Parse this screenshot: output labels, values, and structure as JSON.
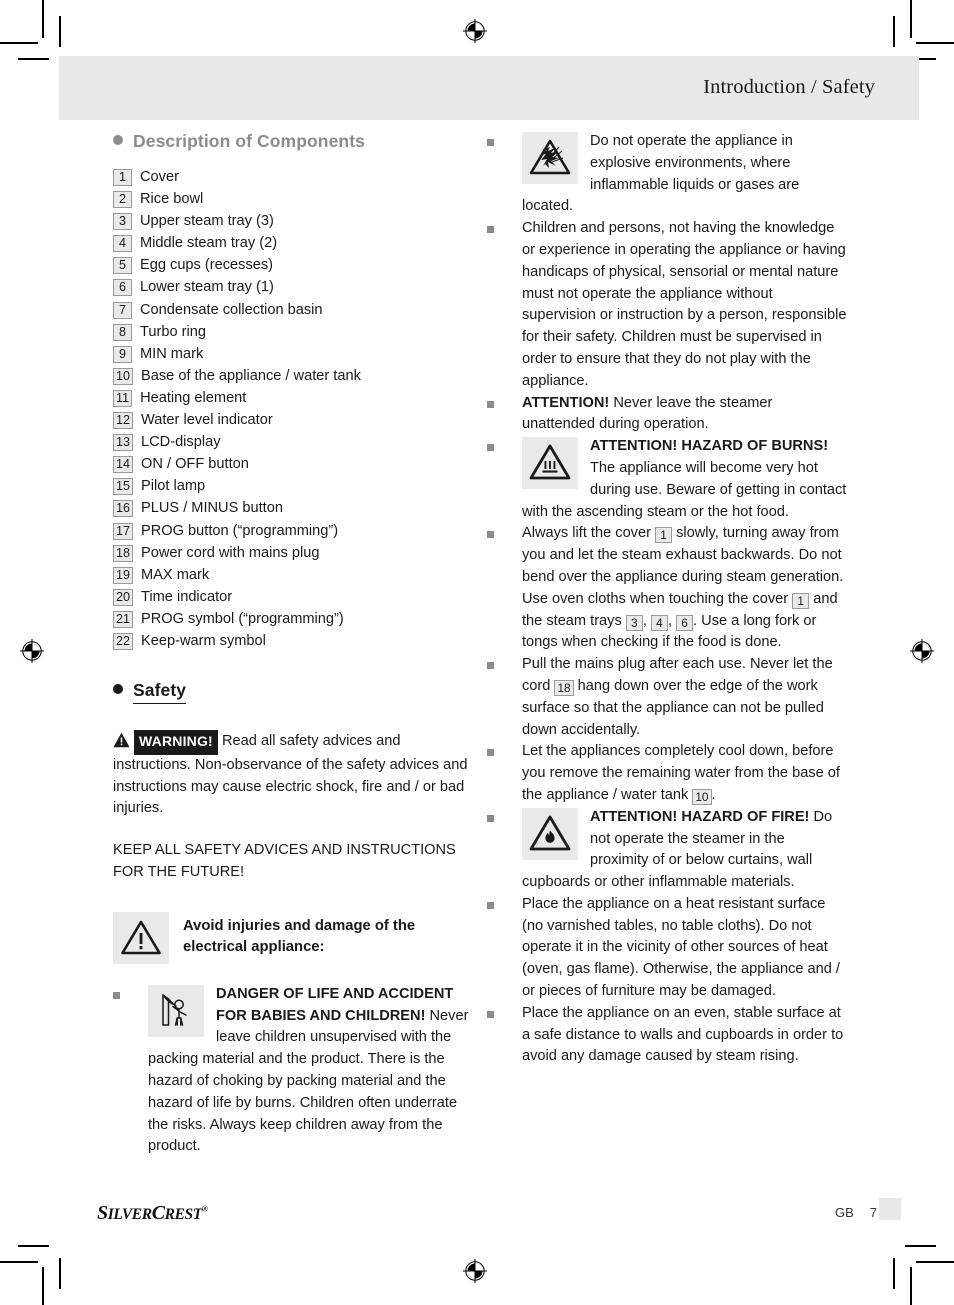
{
  "header": {
    "title": "Introduction / Safety"
  },
  "sections": {
    "components": {
      "heading": "Description of Components",
      "bullet_icon": "filled-circle-icon",
      "items": [
        {
          "num": "1",
          "label": "Cover"
        },
        {
          "num": "2",
          "label": "Rice bowl"
        },
        {
          "num": "3",
          "label": "Upper steam tray (3)"
        },
        {
          "num": "4",
          "label": "Middle steam tray (2)"
        },
        {
          "num": "5",
          "label": "Egg cups (recesses)"
        },
        {
          "num": "6",
          "label": "Lower steam tray (1)"
        },
        {
          "num": "7",
          "label": "Condensate collection basin"
        },
        {
          "num": "8",
          "label": "Turbo ring"
        },
        {
          "num": "9",
          "label": "MIN mark"
        },
        {
          "num": "10",
          "label": "Base of the appliance / water tank"
        },
        {
          "num": "11",
          "label": "Heating element"
        },
        {
          "num": "12",
          "label": "Water level indicator"
        },
        {
          "num": "13",
          "label": "LCD-display"
        },
        {
          "num": "14",
          "label": "ON / OFF button"
        },
        {
          "num": "15",
          "label": "Pilot lamp"
        },
        {
          "num": "16",
          "label": "PLUS / MINUS button"
        },
        {
          "num": "17",
          "label": "PROG button (“programming”)"
        },
        {
          "num": "18",
          "label": "Power cord with mains plug"
        },
        {
          "num": "19",
          "label": "MAX mark"
        },
        {
          "num": "20",
          "label": "Time indicator"
        },
        {
          "num": "21",
          "label": "PROG symbol (“programming”)"
        },
        {
          "num": "22",
          "label": "Keep-warm symbol"
        }
      ]
    },
    "safety": {
      "heading": "Safety",
      "bullet_icon": "filled-circle-icon",
      "warning_badge": "WARNING!",
      "warning_icon": "warning-triangle-icon",
      "warning_text": "Read all safety advices and instructions. Non-observance of the safety advices and instructions may cause electric shock, fire and / or bad injuries.",
      "keep_notice": "KEEP ALL SAFETY ADVICES AND INSTRUCTIONS FOR THE FUTURE!",
      "avoid_callout": {
        "icon": "warning-triangle-icon",
        "text": "Avoid injuries and damage of the electrical appliance:"
      },
      "bullets": [
        {
          "icon": "child-packing-material-icon",
          "lead": "DANGER OF LIFE AND ACCI­DENT FOR BABIES AND CHILDREN!",
          "text": " Never leave children unsupervised with the packing material and the product. There is the hazard of choking by packing material and the hazard of life by burns. Children often underrate the risks. Always keep children away from the product."
        }
      ]
    },
    "right_column": {
      "bullets": [
        {
          "icon": "explosion-hazard-icon",
          "lead": "",
          "text": "Do not operate the appliance in explosive environments, where inflammable liquids or gases are located."
        },
        {
          "icon": "",
          "lead": "",
          "text": "Children and persons, not having the knowledge or experience in operating the appliance or having handicaps of physical, sensorial or mental nature must not operate the appliance without supervision or instruction by a person, responsible for their safety. Children must be supervised in order to ensure that they do not play with the appliance."
        },
        {
          "icon": "",
          "lead": "ATTENTION!",
          "text": " Never leave the steamer unattended during operation."
        },
        {
          "icon": "hot-surface-hazard-icon",
          "lead": "ATTENTION! HAZARD OF BURNS!",
          "text": " The appliance will become very hot during use. Beware of get­ting in contact with the ascending steam or the hot food."
        },
        {
          "icon": "",
          "lead": "",
          "text_parts": [
            {
              "t": "Always lift the cover "
            },
            {
              "ref": "1"
            },
            {
              "t": " slowly, turning away from you and let the steam exhaust backwards. Do not bend over the appliance during steam generation. Use oven cloths when touching the cover "
            },
            {
              "ref": "1"
            },
            {
              "t": " and the steam trays "
            },
            {
              "ref": "3"
            },
            {
              "t": ", "
            },
            {
              "ref": "4"
            },
            {
              "t": ", "
            },
            {
              "ref": "6"
            },
            {
              "t": ". Use a long fork or tongs when checking if the food is done."
            }
          ]
        },
        {
          "icon": "",
          "lead": "",
          "text_parts": [
            {
              "t": "Pull the mains plug after each use. Never let the cord "
            },
            {
              "ref": "18"
            },
            {
              "t": " hang down over the edge of the work surface so that the appliance can not be pulled down accidentally."
            }
          ]
        },
        {
          "icon": "",
          "lead": "",
          "text_parts": [
            {
              "t": "Let the appliances completely cool down, before you remove the remaining water from the base of the appliance / water tank "
            },
            {
              "ref": "10"
            },
            {
              "t": "."
            }
          ]
        },
        {
          "icon": "fire-hazard-icon",
          "lead": "ATTENTION! HAZARD OF FIRE!",
          "text": " Do not operate the steamer in the proximity of or below curtains, wall cupboards or other inflammable materials."
        },
        {
          "icon": "",
          "lead": "",
          "text": "Place the appliance on a heat resistant surface (no varnished tables, no table cloths). Do not operate it in the vicinity of other sources of heat (oven, gas flame). Otherwise, the appli­ance and / or pieces of furniture may be dam­aged."
        },
        {
          "icon": "",
          "lead": "",
          "text": "Place the appliance on an even, stable surface at a safe distance to walls and cupboards in order to avoid any damage caused by steam rising."
        }
      ]
    }
  },
  "footer": {
    "brand_first": "Silver",
    "brand_second": "Crest",
    "brand_trademark": "®",
    "locale": "GB",
    "page_number": "7"
  },
  "colors": {
    "header_band": "#e8e8e8",
    "heading_gray": "#8c8c8c",
    "numbox_fill": "#e9e9e9",
    "numbox_border": "#9a9a9a",
    "icon_plate": "#e9e9e9",
    "text": "#1a1a1a"
  }
}
